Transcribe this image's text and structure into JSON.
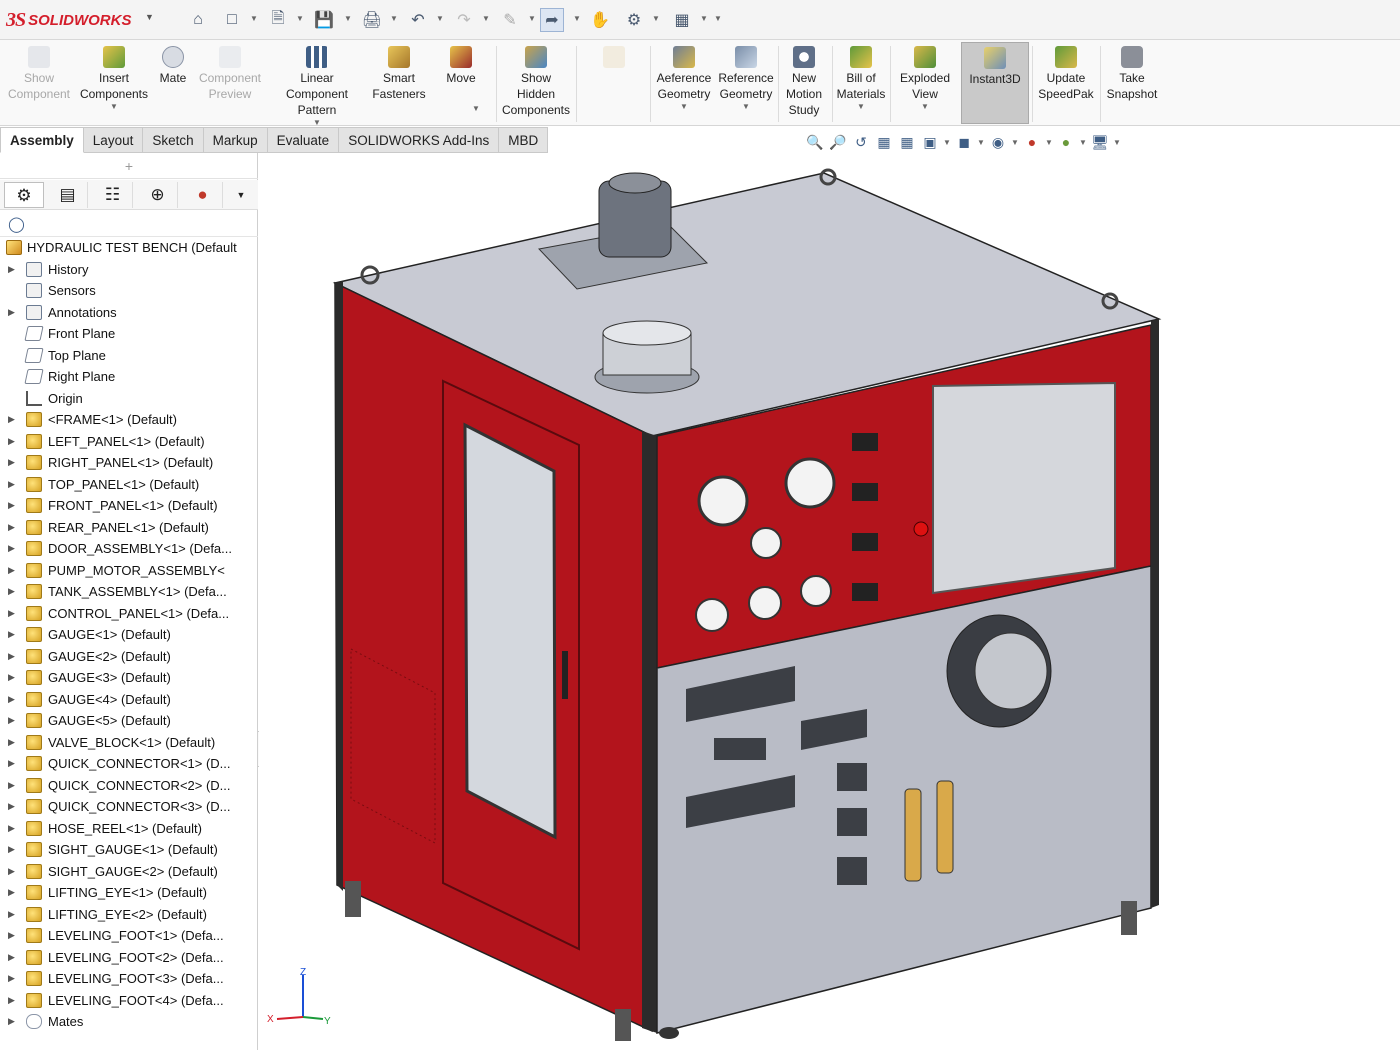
{
  "titlebar": {
    "logo_ds": "3S",
    "logo_text": "SOLIDWORKS"
  },
  "command_manager": {
    "buttons": [
      {
        "label1": "Show",
        "label2": "Component",
        "label3": "",
        "icon": "show-component-icon",
        "disabled": true
      },
      {
        "label1": "Insert",
        "label2": "Components",
        "label3": "",
        "icon": "insert-components-icon",
        "disabled": false,
        "dropdown": true
      },
      {
        "label1": "Mate",
        "label2": "",
        "label3": "",
        "icon": "mate-icon",
        "disabled": false
      },
      {
        "label1": "Component",
        "label2": "Preview",
        "label3": "",
        "icon": "component-preview-icon",
        "disabled": true
      },
      {
        "label1": "Linear Component",
        "label2": "Pattern",
        "label3": "",
        "icon": "linear-pattern-icon",
        "disabled": false,
        "dropdown": true
      },
      {
        "label1": "Smart",
        "label2": "Fasteners",
        "label3": "",
        "icon": "smart-fasteners-icon",
        "disabled": false
      },
      {
        "label1": "Move",
        "label2": "",
        "label3": "",
        "icon": "move-component-icon",
        "disabled": false,
        "dropdown": true
      },
      {
        "label1": "Show",
        "label2": "Hidden",
        "label3": "Components",
        "icon": "show-hidden-icon",
        "disabled": false
      },
      {
        "label1": "Aeference",
        "label2": "Geometry",
        "label3": "",
        "icon": "assembly-features-icon",
        "disabled": false,
        "dropdown": true
      },
      {
        "label1": "Reference",
        "label2": "Geometry",
        "label3": "",
        "icon": "reference-geometry-icon",
        "disabled": false,
        "dropdown": true
      },
      {
        "label1": "New",
        "label2": "Motion",
        "label3": "Study",
        "icon": "motion-study-icon",
        "disabled": false
      },
      {
        "label1": "Bill of",
        "label2": "Materials",
        "label3": "",
        "icon": "bom-icon",
        "disabled": false,
        "dropdown": true
      },
      {
        "label1": "Exploded",
        "label2": "View",
        "label3": "",
        "icon": "exploded-view-icon",
        "disabled": false,
        "dropdown": true
      },
      {
        "label1": "Instant3D",
        "label2": "",
        "label3": "",
        "icon": "instant3d-icon",
        "disabled": false,
        "pressed": true
      },
      {
        "label1": "Update",
        "label2": "SpeedPak",
        "label3": "",
        "icon": "speedpak-icon",
        "disabled": false
      },
      {
        "label1": "Take",
        "label2": "Snapshot",
        "label3": "",
        "icon": "snapshot-icon",
        "disabled": false
      }
    ]
  },
  "tabs": [
    "Assembly",
    "Layout",
    "Sketch",
    "Markup",
    "Evaluate",
    "SOLIDWORKS Add-Ins",
    "MBD"
  ],
  "active_tab": "Assembly",
  "feature_tree": {
    "root": "HYDRAULIC TEST BENCH  (Default",
    "items": [
      {
        "label": "History",
        "icon": "history-folder-icon",
        "type": "folder",
        "expand": true
      },
      {
        "label": "Sensors",
        "icon": "sensors-folder-icon",
        "type": "folder",
        "expand": false
      },
      {
        "label": "Annotations",
        "icon": "annotations-folder-icon",
        "type": "folder",
        "expand": true
      },
      {
        "label": "Front Plane",
        "icon": "plane-icon",
        "type": "plane",
        "expand": false
      },
      {
        "label": "Top Plane",
        "icon": "plane-icon",
        "type": "plane",
        "expand": false
      },
      {
        "label": "Right Plane",
        "icon": "plane-icon",
        "type": "plane",
        "expand": false
      },
      {
        "label": "Origin",
        "icon": "origin-icon",
        "type": "origin",
        "expand": false
      },
      {
        "label": "<FRAME<1>  (Default)",
        "icon": "part-icon",
        "type": "part",
        "expand": true
      },
      {
        "label": "LEFT_PANEL<1>  (Default)",
        "icon": "part-icon",
        "type": "part",
        "expand": true
      },
      {
        "label": "RIGHT_PANEL<1>  (Default)",
        "icon": "part-icon",
        "type": "part",
        "expand": true
      },
      {
        "label": "TOP_PANEL<1>  (Default)",
        "icon": "part-icon",
        "type": "part",
        "expand": true
      },
      {
        "label": "FRONT_PANEL<1>  (Default)",
        "icon": "part-icon",
        "type": "part",
        "expand": true
      },
      {
        "label": "REAR_PANEL<1>  (Default)",
        "icon": "part-icon",
        "type": "part",
        "expand": true
      },
      {
        "label": "DOOR_ASSEMBLY<1>  (Defa...",
        "icon": "part-icon",
        "type": "part",
        "expand": true
      },
      {
        "label": "PUMP_MOTOR_ASSEMBLY<",
        "icon": "part-icon",
        "type": "part",
        "expand": true
      },
      {
        "label": "TANK_ASSEMBLY<1>  (Defa...",
        "icon": "part-icon",
        "type": "part",
        "expand": true
      },
      {
        "label": "CONTROL_PANEL<1>  (Defa...",
        "icon": "part-icon",
        "type": "part",
        "expand": true
      },
      {
        "label": "GAUGE<1>  (Default)",
        "icon": "part-icon",
        "type": "part",
        "expand": true
      },
      {
        "label": "GAUGE<2>  (Default)",
        "icon": "part-icon",
        "type": "part",
        "expand": true
      },
      {
        "label": "GAUGE<3>  (Default)",
        "icon": "part-icon",
        "type": "part",
        "expand": true
      },
      {
        "label": "GAUGE<4>  (Default)",
        "icon": "part-icon",
        "type": "part",
        "expand": true
      },
      {
        "label": "GAUGE<5>  (Default)",
        "icon": "part-icon",
        "type": "part",
        "expand": true
      },
      {
        "label": "VALVE_BLOCK<1>  (Default)",
        "icon": "part-icon",
        "type": "part",
        "expand": true
      },
      {
        "label": "QUICK_CONNECTOR<1>  (D...",
        "icon": "part-icon",
        "type": "part",
        "expand": true
      },
      {
        "label": "QUICK_CONNECTOR<2>  (D...",
        "icon": "part-icon",
        "type": "part",
        "expand": true
      },
      {
        "label": "QUICK_CONNECTOR<3>  (D...",
        "icon": "part-icon",
        "type": "part",
        "expand": true
      },
      {
        "label": "HOSE_REEL<1>  (Default)",
        "icon": "part-icon",
        "type": "part",
        "expand": true
      },
      {
        "label": "SIGHT_GAUGE<1>  (Default)",
        "icon": "part-icon",
        "type": "part",
        "expand": true
      },
      {
        "label": "SIGHT_GAUGE<2>  (Default)",
        "icon": "part-icon",
        "type": "part",
        "expand": true
      },
      {
        "label": "LIFTING_EYE<1>  (Default)",
        "icon": "part-icon",
        "type": "part",
        "expand": true
      },
      {
        "label": "LIFTING_EYE<2>  (Default)",
        "icon": "part-icon",
        "type": "part",
        "expand": true
      },
      {
        "label": "LEVELING_FOOT<1>  (Defa...",
        "icon": "part-icon",
        "type": "part",
        "expand": true
      },
      {
        "label": "LEVELING_FOOT<2>  (Defa...",
        "icon": "part-icon",
        "type": "part",
        "expand": true
      },
      {
        "label": "LEVELING_FOOT<3>  (Defa...",
        "icon": "part-icon",
        "type": "part",
        "expand": true
      },
      {
        "label": "LEVELING_FOOT<4>  (Defa...",
        "icon": "part-icon",
        "type": "part",
        "expand": true
      },
      {
        "label": "Mates",
        "icon": "mates-icon",
        "type": "mates",
        "expand": true
      }
    ]
  },
  "triad": {
    "x": "X",
    "y": "Y",
    "z": "Z"
  },
  "colors": {
    "brand_red": "#d41e2b",
    "panel_red": "#b3141c",
    "panel_gray": "#b9bcc6",
    "top_gray": "#c8cad3",
    "frame_dark": "#2b2b2b"
  }
}
